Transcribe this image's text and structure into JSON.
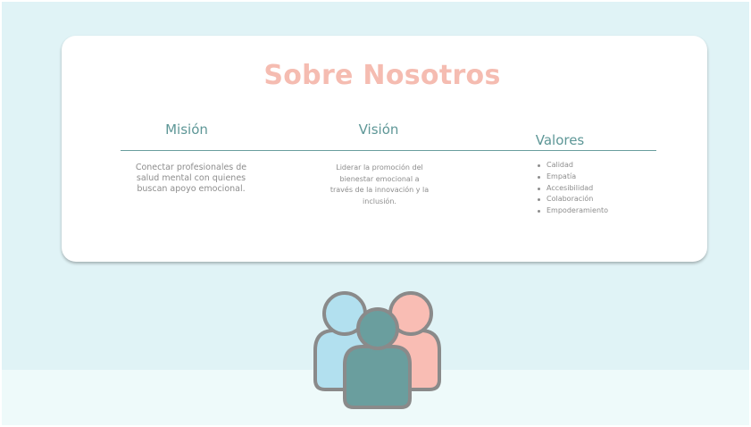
{
  "about": {
    "title": "Sobre Nosotros",
    "mision": {
      "heading": "Misión",
      "text": "Conectar profesionales de salud mental con quienes buscan apoyo emocional."
    },
    "vision": {
      "heading": "Visión",
      "text": "Liderar la promoción del bienestar emocional a través de la innovación y la inclusión."
    },
    "valores": {
      "heading": "Valores",
      "items": [
        "Calidad",
        "Empatía",
        "Accesibilidad",
        "Colaboración",
        "Empoderamiento"
      ]
    }
  },
  "illustration": {
    "icon": "team-icon",
    "colors": {
      "left_person": "#b2e0ef",
      "right_person": "#f9bdb4",
      "center_person": "#6a9e9e",
      "outline": "#8a8a8a"
    }
  },
  "colors": {
    "background_top": "#e0f3f6",
    "background_bottom": "#eefafa",
    "title": "#f5bcb1",
    "heading": "#5e9797",
    "body_text": "#8d8d8d"
  }
}
